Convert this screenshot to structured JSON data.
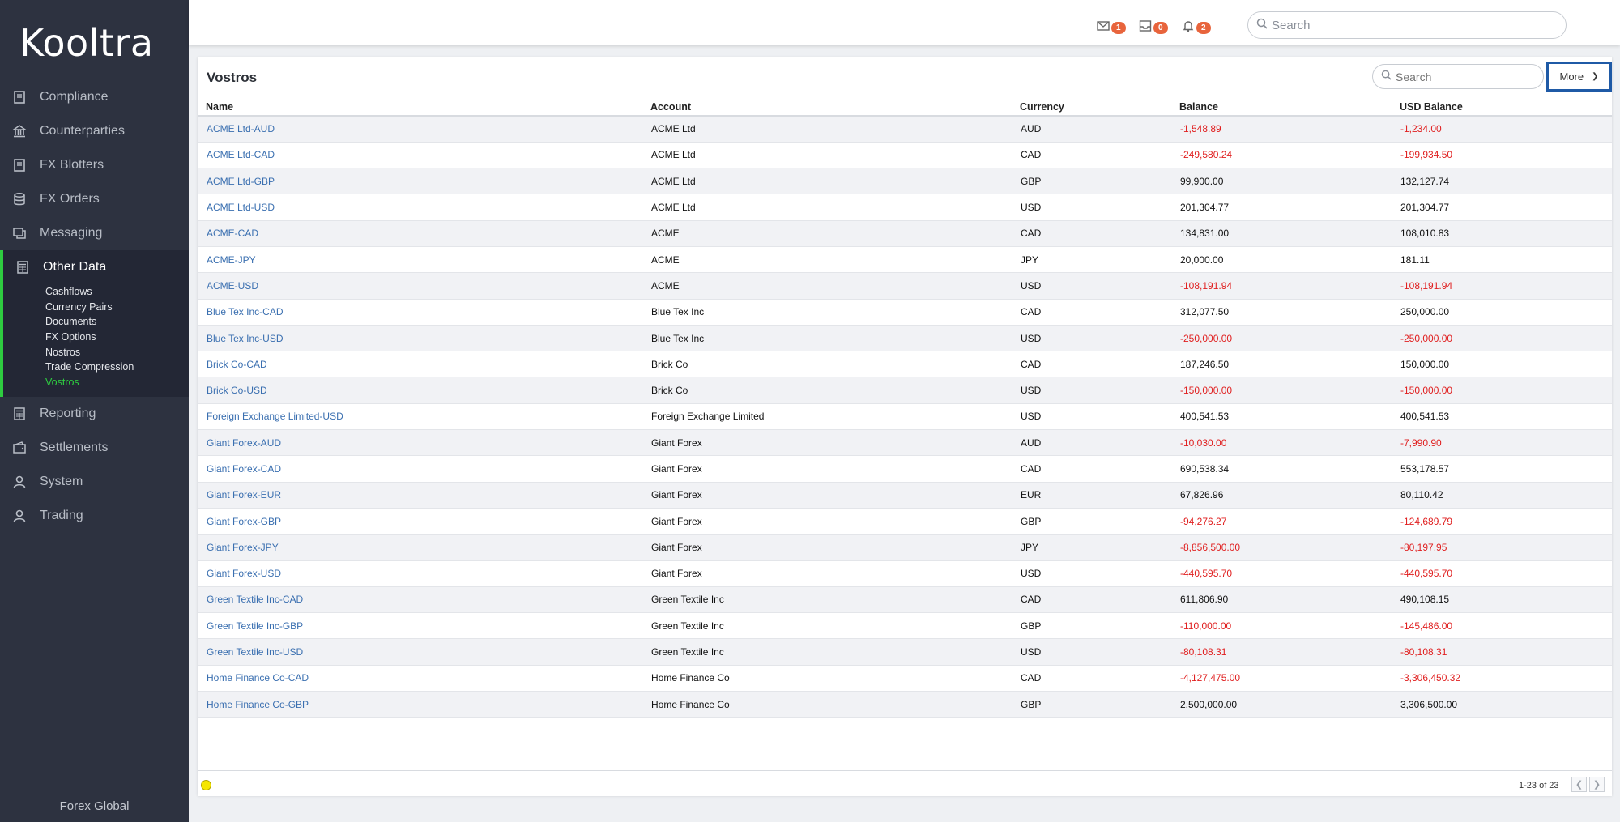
{
  "app": {
    "logo": "Kooltra",
    "footer": "Forex Global"
  },
  "sidebar": {
    "items": [
      {
        "label": "Compliance",
        "icon": "book-icon"
      },
      {
        "label": "Counterparties",
        "icon": "bank-icon"
      },
      {
        "label": "FX Blotters",
        "icon": "book-icon"
      },
      {
        "label": "FX Orders",
        "icon": "database-icon"
      },
      {
        "label": "Messaging",
        "icon": "chat-icon"
      },
      {
        "label": "Other Data",
        "icon": "calculator-icon"
      },
      {
        "label": "Reporting",
        "icon": "calculator-icon"
      },
      {
        "label": "Settlements",
        "icon": "wallet-icon"
      },
      {
        "label": "System",
        "icon": "user-icon"
      },
      {
        "label": "Trading",
        "icon": "user-icon"
      }
    ],
    "subitems": [
      "Cashflows",
      "Currency Pairs",
      "Documents",
      "FX Options",
      "Nostros",
      "Trade Compression",
      "Vostros"
    ],
    "active_subitem": "Vostros",
    "accent_color": "#2ecc40"
  },
  "topbar": {
    "mail_count": "1",
    "inbox_count": "0",
    "alert_count": "2",
    "search_placeholder": "Search"
  },
  "panel": {
    "title": "Vostros",
    "search_placeholder": "Search",
    "more_label": "More",
    "columns": [
      "Name",
      "Account",
      "Currency",
      "Balance",
      "USD Balance"
    ],
    "rows": [
      [
        "ACME Ltd-AUD",
        "ACME Ltd",
        "AUD",
        "-1,548.89",
        "-1,234.00"
      ],
      [
        "ACME Ltd-CAD",
        "ACME Ltd",
        "CAD",
        "-249,580.24",
        "-199,934.50"
      ],
      [
        "ACME Ltd-GBP",
        "ACME Ltd",
        "GBP",
        "99,900.00",
        "132,127.74"
      ],
      [
        "ACME Ltd-USD",
        "ACME Ltd",
        "USD",
        "201,304.77",
        "201,304.77"
      ],
      [
        "ACME-CAD",
        "ACME",
        "CAD",
        "134,831.00",
        "108,010.83"
      ],
      [
        "ACME-JPY",
        "ACME",
        "JPY",
        "20,000.00",
        "181.11"
      ],
      [
        "ACME-USD",
        "ACME",
        "USD",
        "-108,191.94",
        "-108,191.94"
      ],
      [
        "Blue Tex Inc-CAD",
        "Blue Tex Inc",
        "CAD",
        "312,077.50",
        "250,000.00"
      ],
      [
        "Blue Tex Inc-USD",
        "Blue Tex Inc",
        "USD",
        "-250,000.00",
        "-250,000.00"
      ],
      [
        "Brick Co-CAD",
        "Brick Co",
        "CAD",
        "187,246.50",
        "150,000.00"
      ],
      [
        "Brick Co-USD",
        "Brick Co",
        "USD",
        "-150,000.00",
        "-150,000.00"
      ],
      [
        "Foreign Exchange Limited-USD",
        "Foreign Exchange Limited",
        "USD",
        "400,541.53",
        "400,541.53"
      ],
      [
        "Giant Forex-AUD",
        "Giant Forex",
        "AUD",
        "-10,030.00",
        "-7,990.90"
      ],
      [
        "Giant Forex-CAD",
        "Giant Forex",
        "CAD",
        "690,538.34",
        "553,178.57"
      ],
      [
        "Giant Forex-EUR",
        "Giant Forex",
        "EUR",
        "67,826.96",
        "80,110.42"
      ],
      [
        "Giant Forex-GBP",
        "Giant Forex",
        "GBP",
        "-94,276.27",
        "-124,689.79"
      ],
      [
        "Giant Forex-JPY",
        "Giant Forex",
        "JPY",
        "-8,856,500.00",
        "-80,197.95"
      ],
      [
        "Giant Forex-USD",
        "Giant Forex",
        "USD",
        "-440,595.70",
        "-440,595.70"
      ],
      [
        "Green Textile Inc-CAD",
        "Green Textile Inc",
        "CAD",
        "611,806.90",
        "490,108.15"
      ],
      [
        "Green Textile Inc-GBP",
        "Green Textile Inc",
        "GBP",
        "-110,000.00",
        "-145,486.00"
      ],
      [
        "Green Textile Inc-USD",
        "Green Textile Inc",
        "USD",
        "-80,108.31",
        "-80,108.31"
      ],
      [
        "Home Finance Co-CAD",
        "Home Finance Co",
        "CAD",
        "-4,127,475.00",
        "-3,306,450.32"
      ],
      [
        "Home Finance Co-GBP",
        "Home Finance Co",
        "GBP",
        "2,500,000.00",
        "3,306,500.00"
      ]
    ],
    "pager_text": "1-23 of 23",
    "link_color": "#3a6fb0",
    "negative_color": "#e02020"
  }
}
